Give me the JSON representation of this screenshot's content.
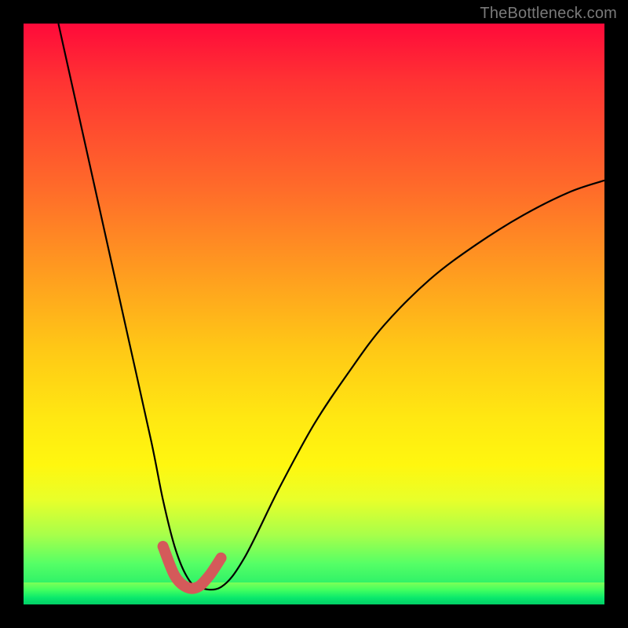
{
  "watermark": "TheBottleneck.com",
  "chart_data": {
    "type": "line",
    "title": "",
    "xlabel": "",
    "ylabel": "",
    "xlim": [
      0,
      100
    ],
    "ylim": [
      0,
      100
    ],
    "series": [
      {
        "name": "main-curve",
        "x": [
          6,
          10,
          14,
          18,
          22,
          24,
          26,
          28,
          30,
          34,
          38,
          44,
          50,
          56,
          62,
          70,
          78,
          86,
          94,
          100
        ],
        "values": [
          100,
          82,
          64,
          46,
          28,
          18,
          10,
          5,
          3,
          3,
          8,
          20,
          31,
          40,
          48,
          56,
          62,
          67,
          71,
          73
        ]
      },
      {
        "name": "highlight-segment",
        "x": [
          24,
          26,
          28,
          30,
          32,
          34
        ],
        "values": [
          10,
          5,
          3,
          3,
          5,
          8
        ]
      }
    ],
    "colors": {
      "curve": "#000000",
      "highlight": "#d45a5a"
    }
  }
}
